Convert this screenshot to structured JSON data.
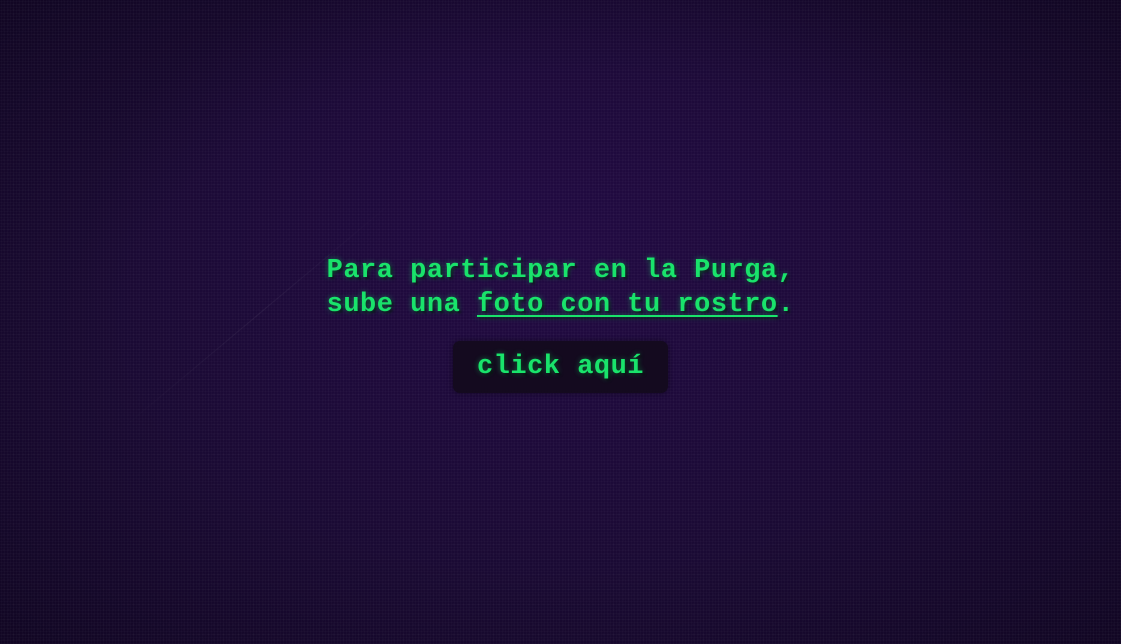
{
  "message": {
    "line1": "Para participar en la Purga,",
    "line2_prefix": "sube una ",
    "link_text": "foto con tu rostro",
    "line2_suffix": "."
  },
  "cta": {
    "label": "click aquí"
  },
  "colors": {
    "background": "#1a0a33",
    "text": "#19e36b",
    "button_background": "#140a1f"
  }
}
